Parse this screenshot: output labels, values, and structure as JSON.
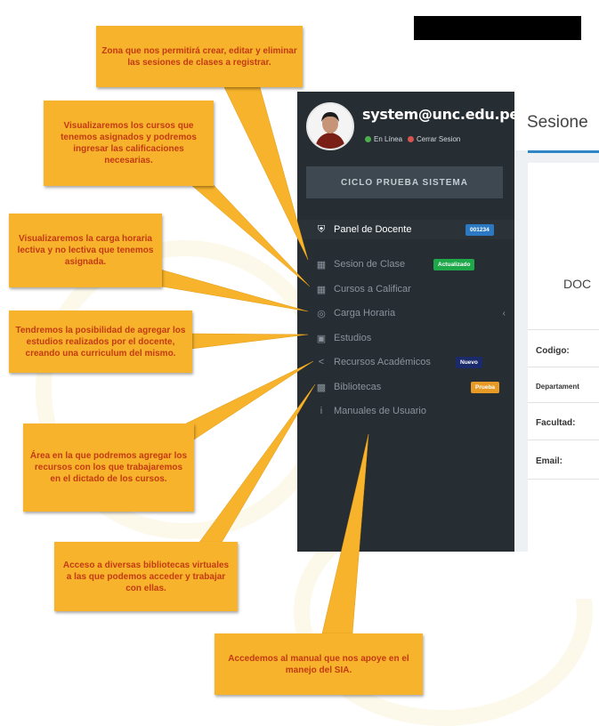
{
  "sidebar": {
    "user_email": "system@unc.edu.pe",
    "status_online": "En Línea",
    "status_logout": "Cerrar Sesion",
    "cycle_button": "CICLO PRUEBA SISTEMA",
    "panel": {
      "label": "Panel de Docente",
      "badge": "001234"
    },
    "items": [
      {
        "label": "Sesion de Clase",
        "icon": "table-icon",
        "badge": "Actualizado",
        "badge_color": "#1ea84a"
      },
      {
        "label": "Cursos a Calificar",
        "icon": "grid-icon"
      },
      {
        "label": "Carga Horaria",
        "icon": "globe-icon"
      },
      {
        "label": "Estudios",
        "icon": "book-icon"
      },
      {
        "label": "Recursos Académicos",
        "icon": "share-icon",
        "badge": "Nuevo",
        "badge_color": "#1b2a6b"
      },
      {
        "label": "Bibliotecas",
        "icon": "library-icon",
        "badge": "Prueba",
        "badge_color": "#e79a25"
      },
      {
        "label": "Manuales de Usuario",
        "icon": "info-icon"
      }
    ]
  },
  "main": {
    "title": "Sesione",
    "doc_label": "DOC",
    "fields": [
      "Codigo:",
      "Departament",
      "Facultad:",
      "Email:"
    ]
  },
  "callouts": {
    "c1": "Zona que nos permitirá crear, editar y eliminar las sesiones de clases a registrar.",
    "c2": "Visualizaremos los cursos que tenemos asignados y podremos ingresar las calificaciones necesarias.",
    "c3": "Visualizaremos la carga horaria lectiva y no lectiva que tenemos asignada.",
    "c4": "Tendremos la posibilidad de agregar los estudios realizados por el docente, creando una curriculum del mismo.",
    "c5": "Área en la que podremos agregar los recursos con los que trabajaremos en el dictado de los cursos.",
    "c6": "Acceso a diversas bibliotecas virtuales a las que podemos acceder y trabajar con ellas.",
    "c7": "Accedemos al manual que nos apoye en el manejo del SIA."
  },
  "colors": {
    "sidebar_bg": "#262d33",
    "callout_bg": "#f7b32b",
    "callout_text": "#c33a13",
    "online": "#4cae4c",
    "logout": "#d9534f"
  }
}
